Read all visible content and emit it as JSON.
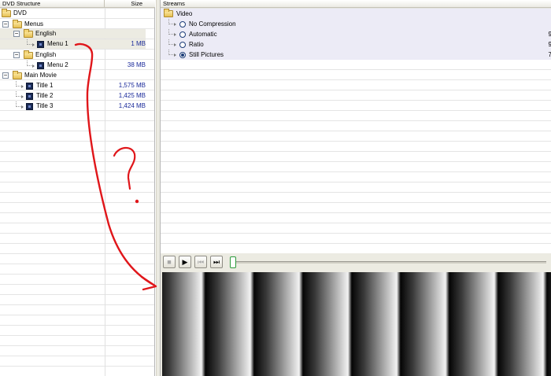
{
  "left_pane": {
    "header": {
      "structure": "DVD Structure",
      "size": "Size"
    },
    "rows": [
      {
        "label": "DVD",
        "size": ""
      },
      {
        "label": "Menus",
        "size": ""
      },
      {
        "label": "English",
        "size": ""
      },
      {
        "label": "Menu 1",
        "size": "1 MB"
      },
      {
        "label": "English",
        "size": ""
      },
      {
        "label": "Menu 2",
        "size": "38 MB"
      },
      {
        "label": "Main Movie",
        "size": ""
      },
      {
        "label": "Title 1",
        "size": "1,575 MB"
      },
      {
        "label": "Title 2",
        "size": "1,425 MB"
      },
      {
        "label": "Title 3",
        "size": "1,424 MB"
      }
    ]
  },
  "streams_pane": {
    "header": "Streams",
    "group": "Video",
    "options": [
      {
        "label": "No Compression",
        "value": "",
        "checked": false
      },
      {
        "label": "Automatic",
        "value": "9",
        "checked": false
      },
      {
        "label": "Ratio",
        "value": "9",
        "checked": false
      },
      {
        "label": "Still Pictures",
        "value": "7",
        "checked": true
      }
    ]
  },
  "player": {
    "stop_glyph": "■",
    "play_glyph": "▶",
    "prev_glyph": "⏮",
    "next_glyph": "⏭",
    "seek_position": 0.0
  },
  "annotation": {
    "question_mark": "?",
    "color": "#e0161a"
  },
  "colors": {
    "selected_row": "#ecebe2",
    "size_text": "#1a2a9a",
    "stream_row": "#ecebf6",
    "panel_bg": "#ecebe2"
  }
}
